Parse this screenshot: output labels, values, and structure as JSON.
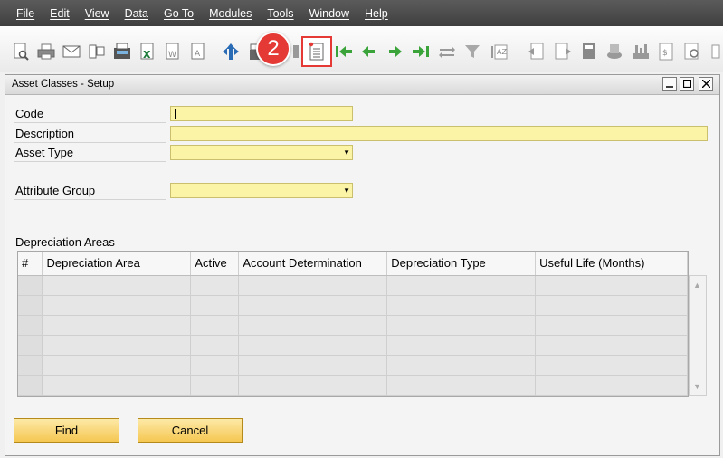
{
  "menu": [
    "File",
    "Edit",
    "View",
    "Data",
    "Go To",
    "Modules",
    "Tools",
    "Window",
    "Help"
  ],
  "toolbar": {
    "icons": [
      "preview-icon",
      "print-icon",
      "email-icon",
      "sms-icon",
      "fax-icon",
      "excel-icon",
      "word-icon",
      "pdf-icon",
      "launch-app-icon",
      "lock-icon",
      "settings-icon",
      "form-settings-icon",
      "first-record-icon",
      "previous-record-icon",
      "next-record-icon",
      "last-record-icon",
      "refresh-icon",
      "filter-icon",
      "sort-icon",
      "base-document-icon",
      "target-document-icon",
      "gross-profit-icon",
      "journal-icon",
      "payment-means-icon",
      "trial-balance-icon",
      "inventory-icon"
    ],
    "highlight_color": "#e53935"
  },
  "step_badge": "2",
  "window": {
    "title": "Asset Classes - Setup"
  },
  "form": {
    "code_label": "Code",
    "code_value": "",
    "description_label": "Description",
    "description_value": "",
    "asset_type_label": "Asset Type",
    "asset_type_value": "",
    "attribute_group_label": "Attribute Group",
    "attribute_group_value": ""
  },
  "depreciation": {
    "section_title": "Depreciation Areas",
    "columns": [
      "#",
      "Depreciation Area",
      "Active",
      "Account Determination",
      "Depreciation Type",
      "Useful Life (Months)"
    ],
    "rows": [
      [
        "",
        "",
        "",
        "",
        "",
        ""
      ],
      [
        "",
        "",
        "",
        "",
        "",
        ""
      ],
      [
        "",
        "",
        "",
        "",
        "",
        ""
      ],
      [
        "",
        "",
        "",
        "",
        "",
        ""
      ],
      [
        "",
        "",
        "",
        "",
        "",
        ""
      ],
      [
        "",
        "",
        "",
        "",
        "",
        ""
      ]
    ]
  },
  "buttons": {
    "find": "Find",
    "cancel": "Cancel"
  },
  "colors": {
    "input_bg": "#fbf3a6",
    "button_bg": "#f5c752"
  }
}
